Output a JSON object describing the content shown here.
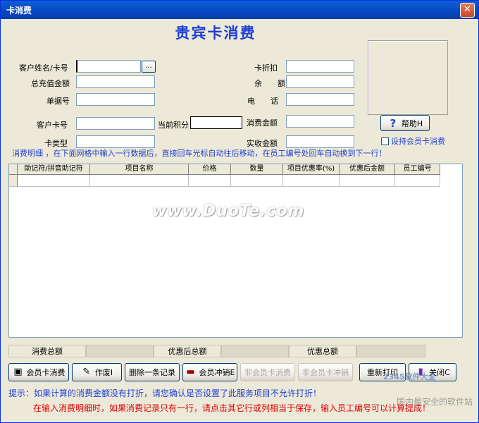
{
  "window": {
    "title": "卡消费"
  },
  "heading": "贵宾卡消费",
  "form": {
    "customer_name": {
      "label": "客户姓名/卡号",
      "value": "",
      "browse": "..."
    },
    "total_recharge": {
      "label": "总充值金额",
      "value": ""
    },
    "bill_no": {
      "label": "单据号",
      "value": ""
    },
    "customer_card": {
      "label": "客户卡号",
      "value": ""
    },
    "card_type": {
      "label": "卡类型",
      "value": ""
    },
    "points": {
      "label": "当前积分",
      "value": ""
    },
    "discount": {
      "label": "卡折扣",
      "value": ""
    },
    "balance": {
      "label": "余　　额",
      "value": ""
    },
    "phone": {
      "label": "电　　话",
      "value": ""
    },
    "consume_amount": {
      "label": "消费金额",
      "value": ""
    },
    "actual_amount": {
      "label": "实收金额",
      "value": ""
    }
  },
  "help_button": "帮助H",
  "support_checkbox": {
    "label": "设持会员卡消费",
    "checked": false
  },
  "section": {
    "title": "消费明细",
    "hint": "，在下面网格中输入一行数据后，直接回车光标自动往后移动，在员工编号处回车自动换到下一行！"
  },
  "grid": {
    "columns": [
      "助记符/拼音助记符",
      "项目名称",
      "价格",
      "数量",
      "项目优惠率(%)",
      "优惠后金额",
      "员工编号"
    ]
  },
  "totals": [
    {
      "label": "消费总额",
      "value": ""
    },
    {
      "label": "优惠后总额",
      "value": ""
    },
    {
      "label": "优惠总额",
      "value": ""
    }
  ],
  "buttons": {
    "member_consume": "会员卡消费",
    "void": "作废I",
    "delete_record": "删除一条记录",
    "member_reverse": "会员冲销E",
    "nonmember_consume": "非会员卡消费",
    "nonmember_reverse": "非会员卡冲销",
    "reprint": "重新打印",
    "close": "关闭C"
  },
  "tips": {
    "tip1": "提示：如果计算的消费金额没有打折，请您确认是否设置了此服务项目不允许打折！",
    "tip2": "在输入消费明细时，如果消费记录只有一行，请点击其它行或列相当于保存，输入员工编号可以计算提成！"
  },
  "watermarks": {
    "main": "www.DuoTe.com",
    "corner1": "2345软件大全",
    "corner2": "国内最安全的软件站"
  },
  "colors": {
    "heading": "#1f3fd6",
    "tip_blue": "#1f3fd6",
    "tip_red": "#e00000",
    "titlebar": "#0a52cc"
  }
}
